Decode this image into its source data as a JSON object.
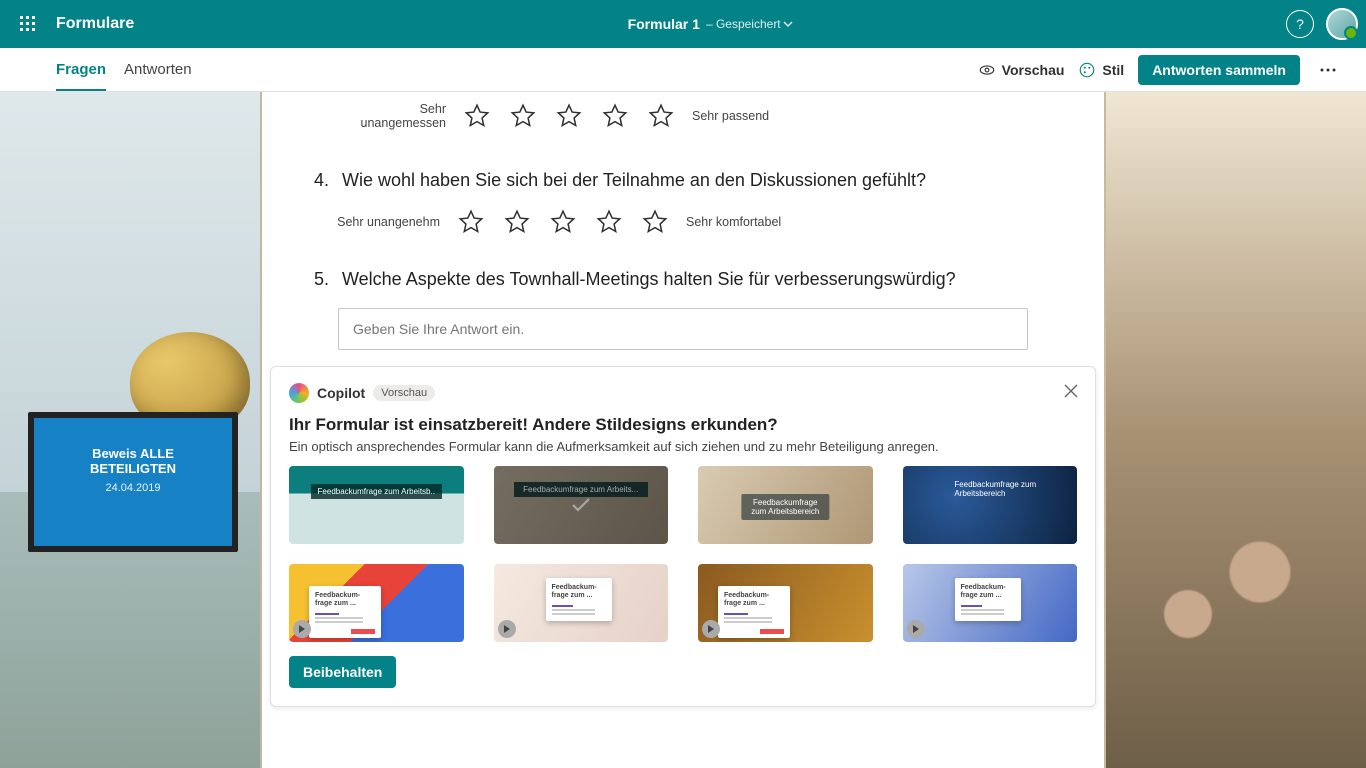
{
  "header": {
    "app_name": "Formulare",
    "form_title": "Formular 1",
    "saved_status": "– Gespeichert"
  },
  "subbar": {
    "tabs": {
      "questions": "Fragen",
      "responses": "Antworten"
    },
    "preview": "Vorschau",
    "style": "Stil",
    "collect": "Antworten sammeln"
  },
  "bg": {
    "slide_title": "Beweis ALLE BETEILIGTEN",
    "slide_date": "24.04.2019"
  },
  "questions": {
    "q3": {
      "left": "Sehr unangemessen",
      "right": "Sehr passend"
    },
    "q4": {
      "num": "4.",
      "text": "Wie wohl haben Sie sich bei der Teilnahme an den Diskussionen gefühlt?",
      "left": "Sehr unangenehm",
      "right": "Sehr komfortabel"
    },
    "q5": {
      "num": "5.",
      "text": "Welche Aspekte des Townhall-Meetings halten Sie für verbesserungswürdig?",
      "placeholder": "Geben Sie Ihre Antwort ein."
    }
  },
  "copilot": {
    "name": "Copilot",
    "badge": "Vorschau",
    "title": "Ihr Formular ist einsatzbereit! Andere Stildesigns erkunden?",
    "subtitle": "Ein optisch ansprechendes Formular kann die Aufmerksamkeit auf sich ziehen und zu mehr Beteiligung anregen.",
    "keep": "Beibehalten",
    "cards": {
      "c1": "Feedbackumfrage zum Arbeitsb..",
      "c2": "Feedbackumfrage zum Arbeits...",
      "c3": "Feedbackumfrage zum Arbeitsbereich",
      "c4": "Feedbackumfrage zum Arbeitsbereich",
      "doc": "Feedbackum-frage zum ..."
    }
  }
}
